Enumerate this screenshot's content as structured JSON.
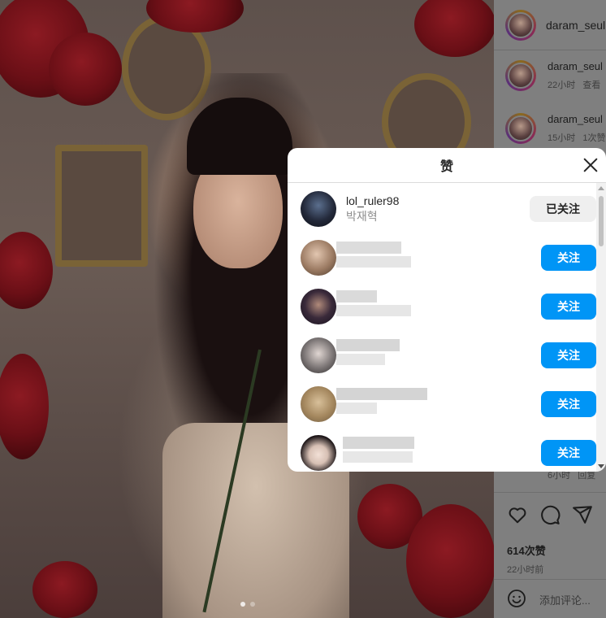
{
  "post": {
    "account": "daram_seul",
    "comments": [
      {
        "user": "daram_seul",
        "time": "22小时",
        "action": "查看"
      },
      {
        "user": "daram_seul",
        "time": "15小时",
        "action": "1次赞"
      }
    ],
    "partial_comment": {
      "time": "6小时",
      "action": "回复"
    },
    "likes": "614次赞",
    "posted": "22小时前",
    "add_comment_placeholder": "添加评论..."
  },
  "likes_modal": {
    "title": "赞",
    "users": [
      {
        "username": "lol_ruler98",
        "name": "박재혁",
        "button": "已关注",
        "following": true
      },
      {
        "username": "",
        "name": "",
        "button": "关注",
        "following": false
      },
      {
        "username": "",
        "name": "",
        "button": "关注",
        "following": false
      },
      {
        "username": "",
        "name": "",
        "button": "关注",
        "following": false
      },
      {
        "username": "",
        "name": "",
        "button": "关注",
        "following": false
      },
      {
        "username": "",
        "name": "",
        "button": "关注",
        "following": false
      }
    ]
  },
  "icons": {
    "close": "close-icon",
    "like": "heart-icon",
    "comment": "comment-icon",
    "share": "send-icon",
    "emoji": "emoji-icon"
  }
}
